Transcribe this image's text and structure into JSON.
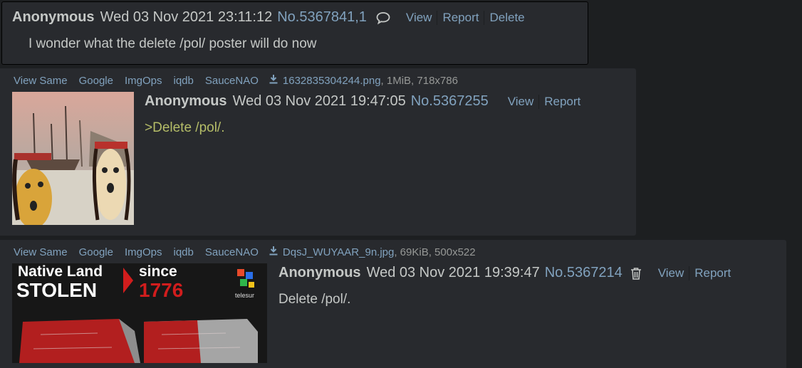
{
  "posts": [
    {
      "name": "Anonymous",
      "date": "Wed 03 Nov 2021 23:11:12",
      "number": "No.5367841,1",
      "actions": [
        "View",
        "Report",
        "Delete"
      ],
      "text": "I wonder what the delete /pol/ poster will do now"
    },
    {
      "file_links": [
        "View Same",
        "Google",
        "ImgOps",
        "iqdb",
        "SauceNAO"
      ],
      "filename": "1632835304244.png",
      "filemeta": ", 1MiB, 718x786",
      "name": "Anonymous",
      "date": "Wed 03 Nov 2021 19:47:05",
      "number": "No.5367255",
      "actions": [
        "View",
        "Report"
      ],
      "text": ">Delete /pol/."
    },
    {
      "file_links": [
        "View Same",
        "Google",
        "ImgOps",
        "iqdb",
        "SauceNAO"
      ],
      "filename": "DqsJ_WUYAAR_9n.jpg",
      "filemeta": ", 69KiB, 500x522",
      "thumb_text": {
        "line1a": "Native Land",
        "line1b": "since",
        "line2a": "STOLEN",
        "line2b": "1776",
        "brand": "telesur"
      },
      "name": "Anonymous",
      "date": "Wed 03 Nov 2021 19:39:47",
      "number": "No.5367214",
      "actions": [
        "View",
        "Report"
      ],
      "text": "Delete /pol/."
    }
  ],
  "colors": {
    "link": "#81a2be",
    "greentext": "#b5bd68",
    "post_bg": "#282a2e",
    "page_bg": "#1d1f21"
  }
}
